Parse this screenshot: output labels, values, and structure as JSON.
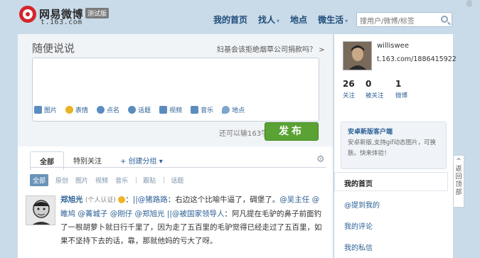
{
  "brand": {
    "name": "网易微博",
    "badge": "测试版",
    "url": "t.163.com"
  },
  "nav": {
    "items": [
      {
        "label": "我的首页",
        "caret": ""
      },
      {
        "label": "找人",
        "caret": "▾"
      },
      {
        "label": "地点",
        "caret": ""
      },
      {
        "label": "微生活",
        "caret": "▾"
      }
    ]
  },
  "search": {
    "placeholder": "搜用户/微博/标签"
  },
  "compose": {
    "title": "随便说说",
    "topic": "妇基会该拒绝烟草公司捐款吗？ >",
    "toolbar": [
      {
        "label": "图片",
        "icon": "image-icon",
        "color": "#5b8cc0"
      },
      {
        "label": "表情",
        "icon": "emoji-icon",
        "color": "#e8b320"
      },
      {
        "label": "点名",
        "icon": "mention-icon",
        "color": "#5b8cc0"
      },
      {
        "label": "话题",
        "icon": "topic-icon",
        "color": "#5b8cc0"
      },
      {
        "label": "视频",
        "icon": "video-icon",
        "color": "#5b8cc0"
      },
      {
        "label": "音乐",
        "icon": "music-icon",
        "color": "#5b8cc0"
      },
      {
        "label": "地点",
        "icon": "location-icon",
        "color": "#7fa6cc"
      }
    ],
    "char_count": "还可以输163字",
    "publish": "发布"
  },
  "feed": {
    "tabs": [
      "全部",
      "特别关注",
      "+ 创建分组 ▾"
    ],
    "filters": [
      "全部",
      "原创",
      "图片",
      "视频",
      "音乐",
      "跟贴",
      "话题"
    ]
  },
  "post": {
    "author": "郑旭光",
    "verified": "(个人认证)",
    "seg1": "：",
    "mention1": "||@猪路路",
    "seg2": "：右边这个比喻牛逼了，碉堡了。",
    "mention2": "@吴主任",
    "mention3": "@睢鸠",
    "mention4": "@菁城子",
    "mention5": "@刚仔",
    "mention6": "@郑旭光",
    "mention7": "||@被国家领导人",
    "seg3": "：阿凡提在毛驴的鼻子前面钓了一根胡萝卜就日行千里了，因为走了五百里的毛驴觉得已经走过了五百里，如果不坚持下去的话，靠，那就他妈的亏大了呀。"
  },
  "profile": {
    "username": "williswee",
    "url": "t.163.com/1886415922",
    "stats": [
      {
        "num": "26",
        "label": "关注"
      },
      {
        "num": "0",
        "label": "被关注"
      },
      {
        "num": "1",
        "label": "微博"
      }
    ]
  },
  "promo": {
    "title": "安卓新版客户端",
    "text": "安卓新版,支持gif动态图片，可换肤。快来体验！"
  },
  "side_nav": [
    "我的首页",
    "@提到我的",
    "我的评论",
    "我的私信"
  ],
  "back_top": "返回顶部",
  "colors": {
    "accent": "#2b5f94",
    "publish": "#5aa233",
    "brand_red": "#d4252c"
  }
}
